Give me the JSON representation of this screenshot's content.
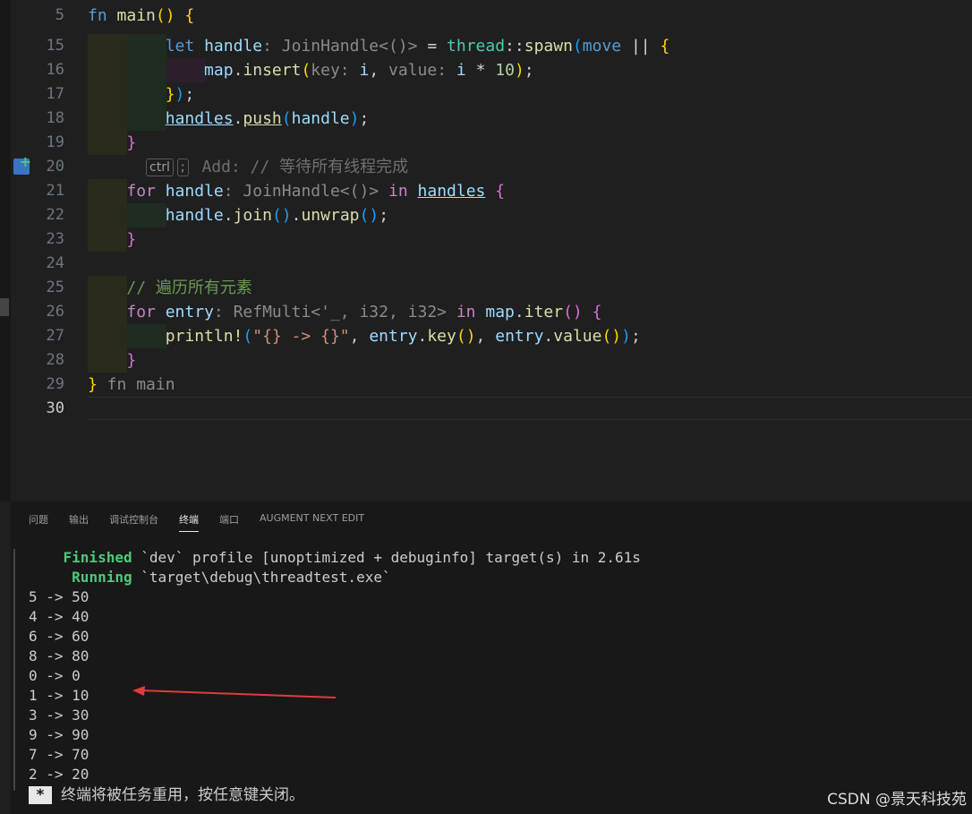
{
  "editor": {
    "lines": [
      {
        "n": "5",
        "html": "<span class='kw'>fn</span> <span class='fn'>main</span><span class='br1'>()</span> <span class='br1'>{</span>"
      },
      {
        "n": "15",
        "html": "        <span class='kw'>let</span> <span class='var'>handle</span><span class='hint'>: JoinHandle&lt;()&gt;</span> <span class='op'>=</span> <span class='typ'>thread</span><span class='op'>::</span><span class='fn'>spawn</span><span class='br3'>(</span><span class='kw'>move</span> <span class='op'>||</span> <span class='br1'>{</span>"
      },
      {
        "n": "16",
        "html": "            <span class='var'>map</span>.<span class='fn'>insert</span><span class='br1'>(</span><span class='hint'>key:</span> <span class='var'>i</span>, <span class='hint'>value:</span> <span class='var'>i</span> <span class='op'>*</span> <span class='num'>10</span><span class='br1'>)</span>;"
      },
      {
        "n": "17",
        "html": "        <span class='br1'>}</span><span class='br3'>)</span>;"
      },
      {
        "n": "18",
        "html": "        <span class='var ul'>handles</span>.<span class='fn ul2'>push</span><span class='br3'>(</span><span class='var'>handle</span><span class='br3'>)</span>;"
      },
      {
        "n": "19",
        "html": "    <span class='br2'>}</span>"
      },
      {
        "n": "20",
        "html": "      <span class='key-badge'>ctrl</span><span class='key-badge'>;</span> <span class='ghost'>Add: // 等待所有线程完成</span>"
      },
      {
        "n": "21",
        "html": "    <span class='kwc'>for</span> <span class='var'>handle</span><span class='hint'>: JoinHandle&lt;()&gt;</span> <span class='kwc'>in</span> <span class='var ul'>handles</span> <span class='br2'>{</span>"
      },
      {
        "n": "22",
        "html": "        <span class='var'>handle</span>.<span class='fn'>join</span><span class='br3'>()</span>.<span class='fn'>unwrap</span><span class='br3'>()</span>;"
      },
      {
        "n": "23",
        "html": "    <span class='br2'>}</span>"
      },
      {
        "n": "24",
        "html": ""
      },
      {
        "n": "25",
        "html": "    <span class='cmt'>// 遍历所有元素</span>"
      },
      {
        "n": "26",
        "html": "    <span class='kwc'>for</span> <span class='var'>entry</span><span class='hint'>: RefMulti&lt;'_, i32, i32&gt;</span> <span class='kwc'>in</span> <span class='var'>map</span>.<span class='fn'>iter</span><span class='br2'>()</span> <span class='br2'>{</span>"
      },
      {
        "n": "27",
        "html": "        <span class='fn'>println!</span><span class='br3'>(</span><span class='str'>\"{} -&gt; {}\"</span>, <span class='var'>entry</span>.<span class='fn'>key</span><span class='br1'>()</span>, <span class='var'>entry</span>.<span class='fn'>value</span><span class='br1'>()</span><span class='br3'>)</span>;"
      },
      {
        "n": "28",
        "html": "    <span class='br2'>}</span>"
      },
      {
        "n": "29",
        "html": "<span class='br1'>}</span><span class='hint'> fn main</span>"
      },
      {
        "n": "30",
        "html": ""
      }
    ]
  },
  "panel": {
    "tabs": [
      "问题",
      "输出",
      "调试控制台",
      "终端",
      "端口",
      "AUGMENT NEXT EDIT"
    ],
    "active_tab": "终端",
    "finished_label": "Finished",
    "finished_text": " `dev` profile [unoptimized + debuginfo] target(s) in 2.61s",
    "running_label": "Running",
    "running_text": " `target\\debug\\threadtest.exe`",
    "output_lines": [
      "5 -> 50",
      "4 -> 40",
      "6 -> 60",
      "8 -> 80",
      "0 -> 0",
      "1 -> 10",
      "3 -> 30",
      "9 -> 90",
      "7 -> 70",
      "2 -> 20"
    ],
    "restart_star": "*",
    "restart_text": "终端将被任务重用，按任意键关闭。"
  },
  "watermark": "CSDN @景天科技苑",
  "colors": {
    "annotation_arrow": "#e03c3c"
  }
}
